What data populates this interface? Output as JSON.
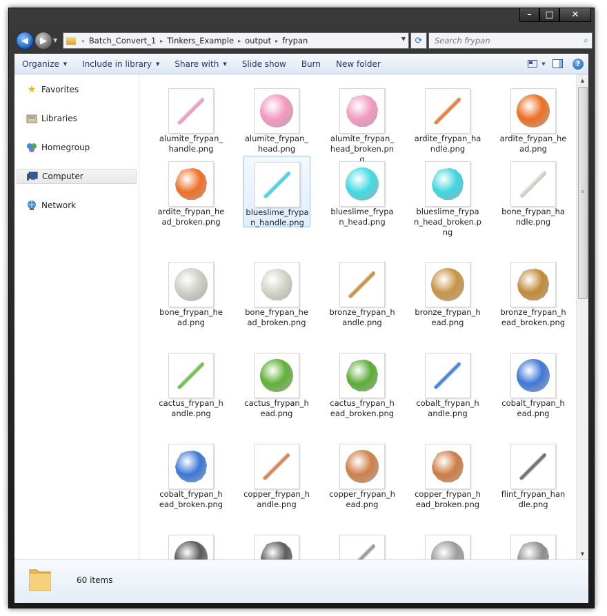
{
  "window": {
    "controls": {
      "minimize": "–",
      "maximize": "□",
      "close": "✕"
    }
  },
  "address": {
    "overflow": "«",
    "crumbs": [
      "Batch_Convert_1",
      "Tinkers_Example",
      "output",
      "frypan"
    ]
  },
  "search": {
    "placeholder": "Search frypan"
  },
  "toolbar": {
    "organize": "Organize",
    "include": "Include in library",
    "share": "Share with",
    "slideshow": "Slide show",
    "burn": "Burn",
    "new_folder": "New folder"
  },
  "nav": {
    "favorites": "Favorites",
    "libraries": "Libraries",
    "homegroup": "Homegroup",
    "computer": "Computer",
    "network": "Network"
  },
  "files": [
    {
      "name": "alumite_frypan_handle.png",
      "kind": "handle",
      "color": "#f19ec4"
    },
    {
      "name": "alumite_frypan_head.png",
      "kind": "head",
      "color": "#f39ac0"
    },
    {
      "name": "alumite_frypan_head_broken.png",
      "kind": "broken",
      "color": "#f29bc1"
    },
    {
      "name": "ardite_frypan_handle.png",
      "kind": "handle",
      "color": "#ef7a2e"
    },
    {
      "name": "ardite_frypan_head.png",
      "kind": "head",
      "color": "#ee6f22"
    },
    {
      "name": "ardite_frypan_head_broken.png",
      "kind": "broken",
      "color": "#ee7026"
    },
    {
      "name": "blueslime_frypan_handle.png",
      "kind": "handle",
      "color": "#3fd8e0"
    },
    {
      "name": "blueslime_frypan_head.png",
      "kind": "head",
      "color": "#44dbe3"
    },
    {
      "name": "blueslime_frypan_head_broken.png",
      "kind": "broken",
      "color": "#3fd6df"
    },
    {
      "name": "bone_frypan_handle.png",
      "kind": "handle",
      "color": "#d8d8cf"
    },
    {
      "name": "bone_frypan_head.png",
      "kind": "head",
      "color": "#cfcfc6"
    },
    {
      "name": "bone_frypan_head_broken.png",
      "kind": "broken",
      "color": "#d3d3ca"
    },
    {
      "name": "bronze_frypan_handle.png",
      "kind": "handle",
      "color": "#c99035"
    },
    {
      "name": "bronze_frypan_head.png",
      "kind": "head",
      "color": "#c99446"
    },
    {
      "name": "bronze_frypan_head_broken.png",
      "kind": "broken",
      "color": "#c18a38"
    },
    {
      "name": "cactus_frypan_handle.png",
      "kind": "handle",
      "color": "#6cc244"
    },
    {
      "name": "cactus_frypan_head.png",
      "kind": "head",
      "color": "#5fb238"
    },
    {
      "name": "cactus_frypan_head_broken.png",
      "kind": "broken",
      "color": "#5aad36"
    },
    {
      "name": "cobalt_frypan_handle.png",
      "kind": "handle",
      "color": "#3f7fe0"
    },
    {
      "name": "cobalt_frypan_head.png",
      "kind": "head",
      "color": "#3e78d8"
    },
    {
      "name": "cobalt_frypan_head_broken.png",
      "kind": "broken",
      "color": "#3b76d9"
    },
    {
      "name": "copper_frypan_handle.png",
      "kind": "handle",
      "color": "#d9834a"
    },
    {
      "name": "copper_frypan_head.png",
      "kind": "head",
      "color": "#d08048"
    },
    {
      "name": "copper_frypan_head_broken.png",
      "kind": "broken",
      "color": "#cf7c43"
    },
    {
      "name": "flint_frypan_handle.png",
      "kind": "handle",
      "color": "#6a6a6a"
    },
    {
      "name": "",
      "kind": "head",
      "color": "#5a5a5a"
    },
    {
      "name": "",
      "kind": "broken",
      "color": "#5c5c5c"
    },
    {
      "name": "",
      "kind": "handle",
      "color": "#9a9a9a"
    },
    {
      "name": "",
      "kind": "head",
      "color": "#9c9c9c"
    },
    {
      "name": "",
      "kind": "broken",
      "color": "#8e8e8e"
    }
  ],
  "selected_index": 6,
  "status": {
    "count": "60 items"
  }
}
